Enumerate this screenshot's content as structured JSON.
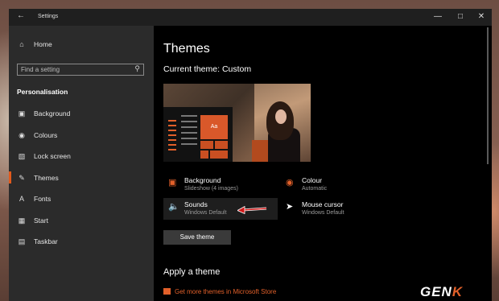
{
  "window": {
    "title": "Settings"
  },
  "sidebar": {
    "home_label": "Home",
    "search_placeholder": "Find a setting",
    "section": "Personalisation",
    "items": [
      {
        "label": "Background",
        "icon": "picture-icon"
      },
      {
        "label": "Colours",
        "icon": "palette-icon"
      },
      {
        "label": "Lock screen",
        "icon": "monitor-icon"
      },
      {
        "label": "Themes",
        "icon": "brush-icon",
        "active": true
      },
      {
        "label": "Fonts",
        "icon": "font-icon"
      },
      {
        "label": "Start",
        "icon": "start-icon"
      },
      {
        "label": "Taskbar",
        "icon": "taskbar-icon"
      }
    ]
  },
  "main": {
    "heading": "Themes",
    "current_theme": "Current theme: Custom",
    "preview_tile_label": "Aa",
    "theme_items": [
      {
        "name": "Background",
        "value": "Slideshow (4 images)",
        "icon": "picture-icon"
      },
      {
        "name": "Colour",
        "value": "Automatic",
        "icon": "palette-icon"
      },
      {
        "name": "Sounds",
        "value": "Windows Default",
        "icon": "speaker-icon"
      },
      {
        "name": "Mouse cursor",
        "value": "Windows Default",
        "icon": "cursor-icon"
      }
    ],
    "save_button": "Save theme",
    "apply_heading": "Apply a theme",
    "store_link": "Get more themes in Microsoft Store"
  },
  "watermark": {
    "brand_a": "GEN",
    "brand_b": "K"
  },
  "colors": {
    "accent": "#e2602a",
    "sidebar_bg": "#2b2b2b",
    "content_bg": "#000000"
  }
}
